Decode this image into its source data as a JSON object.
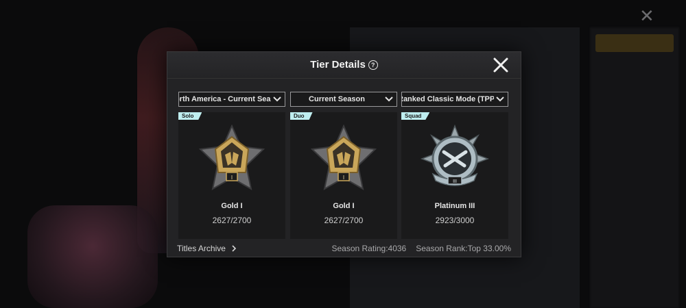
{
  "dialog": {
    "title": "Tier Details",
    "help_icon": "question-circle-icon",
    "close_icon": "close-x-icon"
  },
  "filters": {
    "region": "North America - Current Season",
    "season": "Current Season",
    "mode": "Ranked Classic Mode (TPP)"
  },
  "cards": [
    {
      "tag": "Solo",
      "tier": "Gold I",
      "points": "2627/2700",
      "badge": "gold-badge-icon"
    },
    {
      "tag": "Duo",
      "tier": "Gold I",
      "points": "2627/2700",
      "badge": "gold-badge-icon"
    },
    {
      "tag": "Squad",
      "tier": "Platinum III",
      "points": "2923/3000",
      "badge": "platinum-badge-icon"
    }
  ],
  "footer": {
    "titles_archive": "Titles Archive",
    "season_rating": "Season Rating:4036",
    "season_rank": "Season Rank:Top 33.00%"
  },
  "colors": {
    "tag_bg": "#bfeef0",
    "gold": "#c9a65a",
    "platinum": "#aebdc4"
  }
}
